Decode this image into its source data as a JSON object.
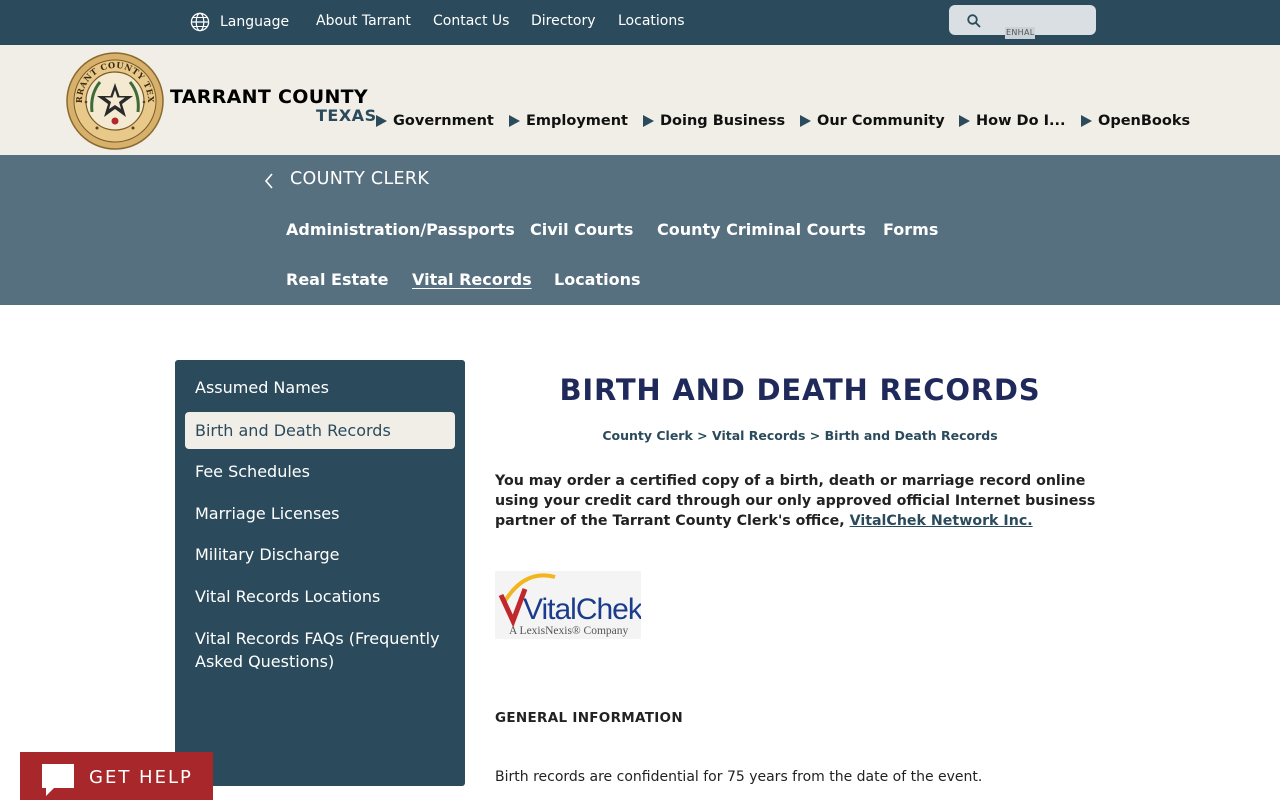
{
  "utility_bar": {
    "language_label": "Language",
    "links": [
      "About Tarrant",
      "Contact Us",
      "Directory",
      "Locations"
    ],
    "search_label": "ENHAL"
  },
  "header": {
    "brand_name": "TARRANT COUNTY",
    "brand_state": "TEXAS",
    "seal_text": "TARRANT COUNTY TEXAS",
    "nav": [
      "Government",
      "Employment",
      "Doing Business",
      "Our Community",
      "How Do I...",
      "OpenBooks"
    ]
  },
  "department": {
    "title": "COUNTY CLERK",
    "nav_row1": [
      "Administration/Passports",
      "Civil Courts",
      "County Criminal Courts",
      "Forms"
    ],
    "nav_row2": [
      "Real Estate",
      "Vital Records",
      "Locations"
    ],
    "active": "Vital Records"
  },
  "sidebar": {
    "items": [
      "Assumed Names",
      "Birth and Death Records",
      "Fee Schedules",
      "Marriage Licenses",
      "Military Discharge",
      "Vital Records Locations",
      "Vital Records FAQs (Frequently Asked Questions)"
    ],
    "active": "Birth and Death Records"
  },
  "main": {
    "title": "BIRTH AND DEATH RECORDS",
    "breadcrumb": [
      "County Clerk",
      "Vital Records",
      "Birth and Death Records"
    ],
    "breadcrumb_sep": ">",
    "intro_text": "You may order a certified copy of a birth, death or marriage record online using your credit card through our only approved official Internet business partner of the Tarrant County Clerk's office, ",
    "intro_link": "VitalChek Network Inc.",
    "logo_name": "VitalChek",
    "logo_tagline": "A LexisNexis® Company",
    "general_heading": "GENERAL INFORMATION",
    "body_text": "Birth records are confidential for 75 years from the date of the event."
  },
  "get_help": {
    "label": "GET HELP"
  },
  "colors": {
    "utility_bar": "#2b4b5c",
    "header_bg": "#f1eee7",
    "dept_band": "#56707f",
    "title": "#1f2a5a",
    "get_help": "#a8272b"
  }
}
